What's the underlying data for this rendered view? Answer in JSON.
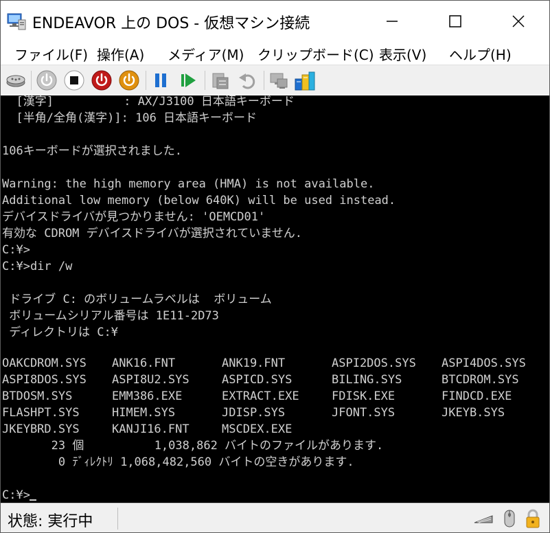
{
  "window": {
    "title": "ENDEAVOR 上の DOS  - 仮想マシン接続"
  },
  "titlebar_icons": [
    "vm-connection-icon",
    "minimize-icon",
    "maximize-icon",
    "close-icon"
  ],
  "menu": [
    {
      "label": "ファイル(F)"
    },
    {
      "label": "操作(A)"
    },
    {
      "label": "メディア(M)"
    },
    {
      "label": "クリップボード(C)"
    },
    {
      "label": "表示(V)"
    },
    {
      "label": "ヘルプ(H)"
    }
  ],
  "toolbar": {
    "buttons": [
      "ctrl-alt-del-icon",
      "start-icon",
      "turn-off-icon",
      "shut-down-icon",
      "save-icon",
      "pause-icon",
      "reset-icon",
      "checkpoint-icon",
      "revert-icon",
      "enhanced-session-icon",
      "share-icon"
    ],
    "colors": {
      "turn_off": "#b0202a",
      "shut_down": "#b01818",
      "save": "#d88a10",
      "pause": "#1e6fd0",
      "reset": "#20a040"
    }
  },
  "console": {
    "lines": [
      "  [漢字]          : AX/J3100 日本語キーボード",
      "  [半角/全角(漢字)]: 106 日本語キーボード",
      "",
      "106キーボードが選択されました.",
      "",
      "Warning: the high memory area (HMA) is not available.",
      "Additional low memory (below 640K) will be used instead.",
      "デバイスドライバが見つかりません: 'OEMCD01'",
      "有効な CDROM デバイスドライバが選択されていません.",
      "C:¥>",
      "C:¥>dir /w",
      "",
      " ドライブ C: のボリュームラベルは  ボリューム",
      " ボリュームシリアル番号は 1E11-2D73",
      " ディレクトリは C:¥",
      "",
      ""
    ],
    "files": [
      [
        "OAKCDROM.SYS",
        "ANK16.FNT",
        "ANK19.FNT",
        "ASPI2DOS.SYS",
        "ASPI4DOS.SYS"
      ],
      [
        "ASPI8DOS.SYS",
        "ASPI8U2.SYS",
        "ASPICD.SYS",
        "BILING.SYS",
        "BTCDROM.SYS"
      ],
      [
        "BTDOSM.SYS",
        "EMM386.EXE",
        "EXTRACT.EXE",
        "FDISK.EXE",
        "FINDCD.EXE"
      ],
      [
        "FLASHPT.SYS",
        "HIMEM.SYS",
        "JDISP.SYS",
        "JFONT.SYS",
        "JKEYB.SYS"
      ],
      [
        "JKEYBRD.SYS",
        "KANJI16.FNT",
        "MSCDEX.EXE"
      ]
    ],
    "summary": [
      "       23 個          1,038,862 バイトのファイルがあります.",
      "        0 ﾃﾞｨﾚｸﾄﾘ 1,068,482,560 バイトの空きがあります."
    ],
    "prompt": "C:¥>"
  },
  "status": {
    "text": "状態: 実行中",
    "icons": [
      "keyboard-icon",
      "mouse-icon",
      "lock-icon"
    ]
  }
}
